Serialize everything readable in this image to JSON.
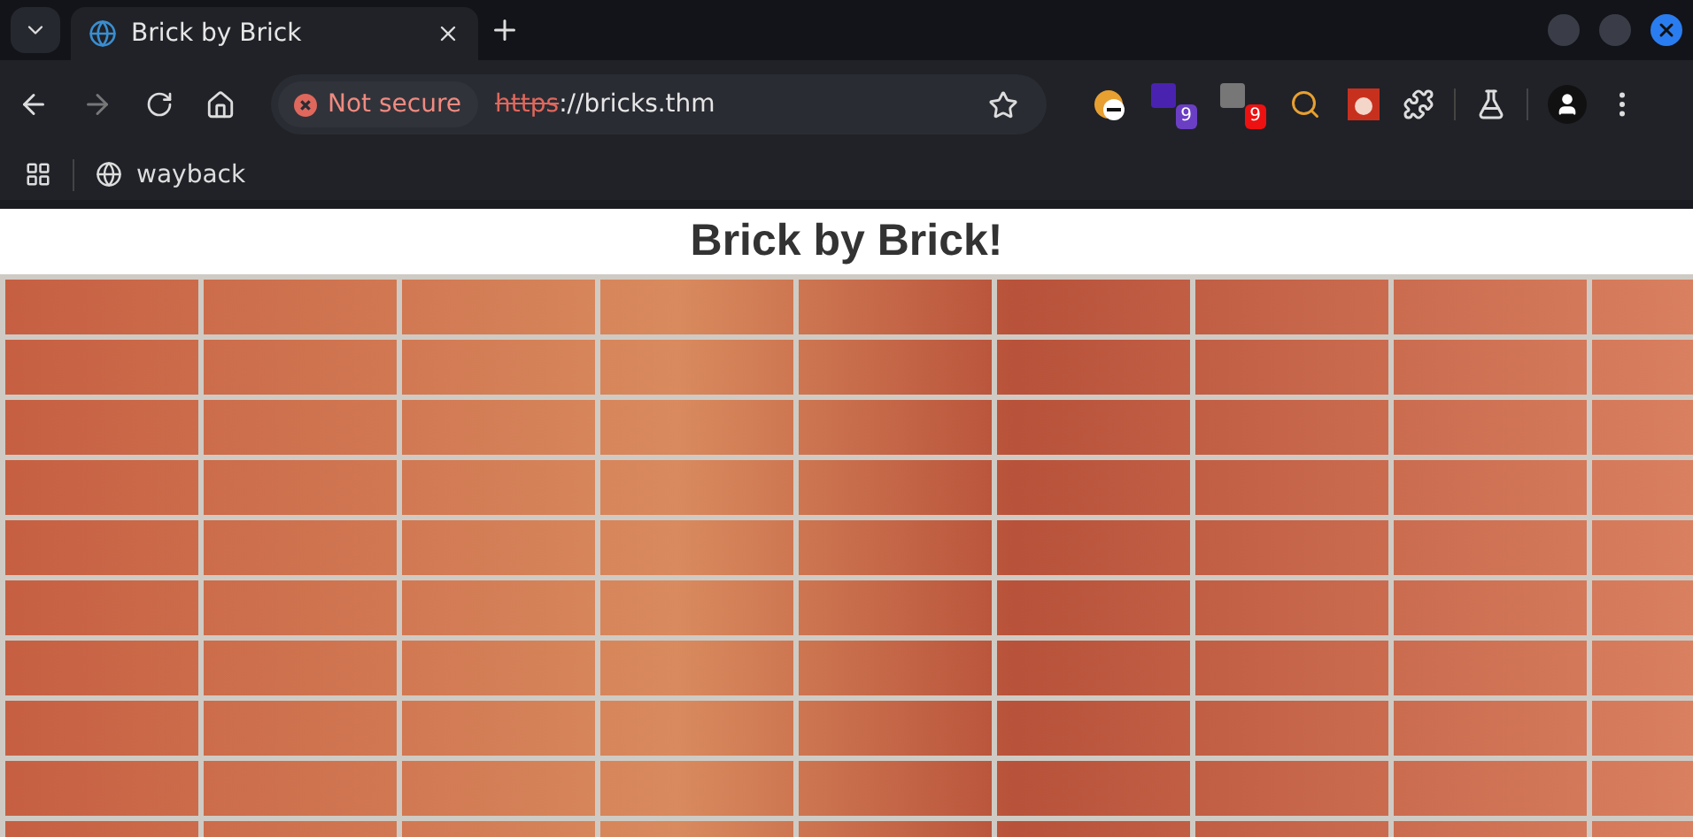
{
  "tab": {
    "title": "Brick by Brick",
    "selected": true
  },
  "address_bar": {
    "security": "Not secure",
    "url_scheme": "https",
    "url_rest": "://bricks.thm"
  },
  "extensions": [
    {
      "kind": "badge",
      "badge": "9",
      "color": "#6b3fc4"
    },
    {
      "kind": "badge",
      "badge": "9",
      "color": "#ee1111"
    }
  ],
  "bookmarks": [
    {
      "label": "wayback"
    }
  ],
  "page": {
    "heading": "Brick by Brick!"
  }
}
